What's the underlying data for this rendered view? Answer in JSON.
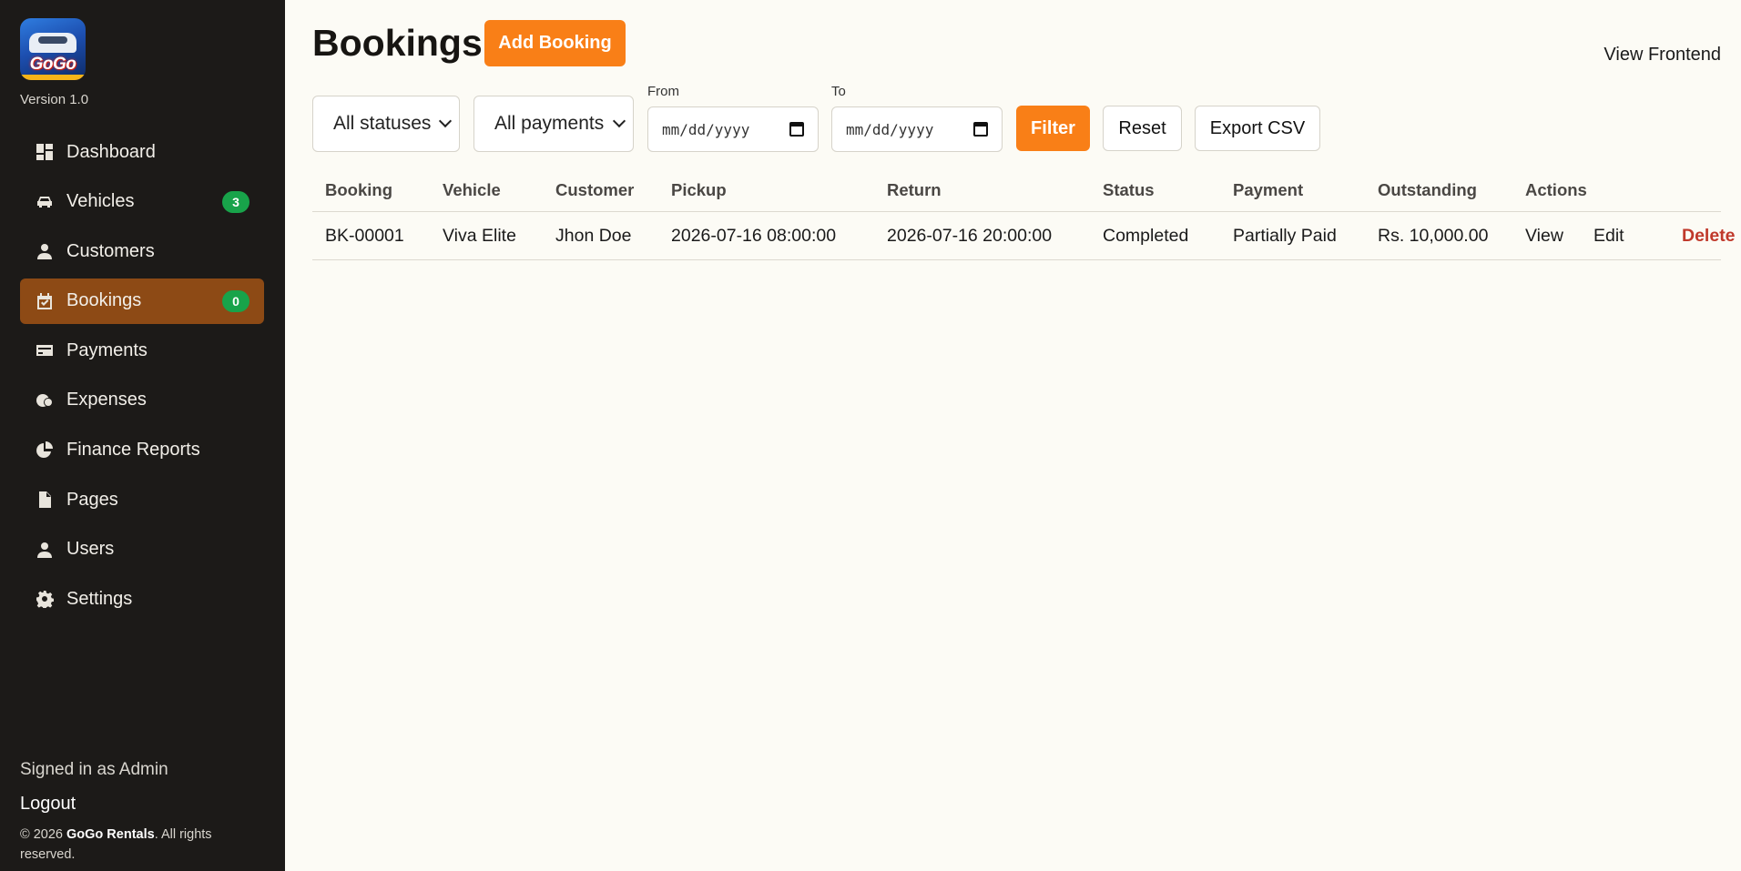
{
  "sidebar": {
    "logo_text": "GoGo",
    "version": "Version 1.0",
    "items": [
      {
        "label": "Dashboard",
        "icon": "dashboard-icon"
      },
      {
        "label": "Vehicles",
        "icon": "car-icon",
        "badge": "3"
      },
      {
        "label": "Customers",
        "icon": "user-icon"
      },
      {
        "label": "Bookings",
        "icon": "calendar-check-icon",
        "badge": "0",
        "active": true
      },
      {
        "label": "Payments",
        "icon": "credit-card-icon"
      },
      {
        "label": "Expenses",
        "icon": "coins-icon"
      },
      {
        "label": "Finance Reports",
        "icon": "pie-chart-icon"
      },
      {
        "label": "Pages",
        "icon": "file-icon"
      },
      {
        "label": "Users",
        "icon": "user-icon"
      },
      {
        "label": "Settings",
        "icon": "gear-icon"
      }
    ],
    "signed_in": "Signed in as Admin",
    "logout": "Logout",
    "copyright_prefix": "© 2026 ",
    "copyright_brand": "GoGo Rentals",
    "copyright_suffix": ". All rights reserved."
  },
  "header": {
    "title": "Bookings",
    "add_button": "Add Booking",
    "view_frontend": "View Frontend"
  },
  "filters": {
    "status_select": "All statuses",
    "payment_select": "All payments",
    "from_label": "From",
    "to_label": "To",
    "date_placeholder": "mm/dd/yyyy",
    "filter_button": "Filter",
    "reset_button": "Reset",
    "export_button": "Export CSV"
  },
  "table": {
    "columns": [
      "Booking",
      "Vehicle",
      "Customer",
      "Pickup",
      "Return",
      "Status",
      "Payment",
      "Outstanding",
      "Actions"
    ],
    "rows": [
      {
        "booking": "BK-00001",
        "vehicle": "Viva Elite",
        "customer": "Jhon Doe",
        "pickup": "2026-07-16 08:00:00",
        "return": "2026-07-16 20:00:00",
        "status": "Completed",
        "payment": "Partially Paid",
        "outstanding": "Rs. 10,000.00",
        "actions": [
          "View",
          "Edit",
          "Delete"
        ]
      }
    ]
  },
  "colors": {
    "accent": "#f97f17",
    "sidebar_bg": "#1c1a18",
    "active_item": "#8d4a15",
    "badge": "#18a34a",
    "danger": "#c0392b"
  }
}
